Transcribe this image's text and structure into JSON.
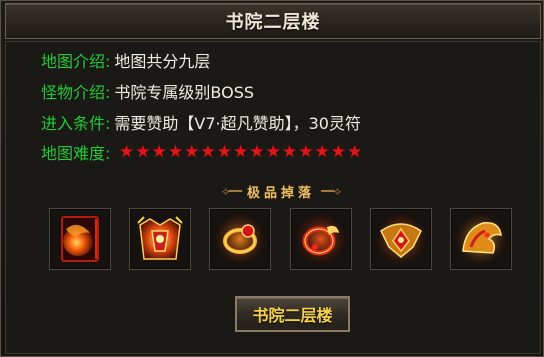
{
  "window": {
    "title": "书院二层楼"
  },
  "info": {
    "intro_label": "地图介绍:",
    "intro_value": "地图共分九层",
    "monster_label": "怪物介绍:",
    "monster_value": "书院专属级别BOSS",
    "entry_label": "进入条件:",
    "entry_value": "需要赞助【V7·超凡赞助】，30灵符",
    "difficulty_label": "地图难度:",
    "difficulty_stars": 15
  },
  "drops": {
    "title": "极品掉落",
    "items": [
      {
        "icon": "fire-scroll-icon"
      },
      {
        "icon": "flame-armor-icon"
      },
      {
        "icon": "fire-ring-icon"
      },
      {
        "icon": "dragon-ring-icon"
      },
      {
        "icon": "jewel-necklace-icon"
      },
      {
        "icon": "phoenix-helmet-icon"
      }
    ]
  },
  "enter_button": {
    "label": "书院二层楼"
  },
  "colors": {
    "label_green": "#23c93a",
    "value_white": "#f1ece2",
    "star_red": "#e0141a",
    "button_text": "#f5d24a",
    "drop_title": "#e8bf6d"
  }
}
